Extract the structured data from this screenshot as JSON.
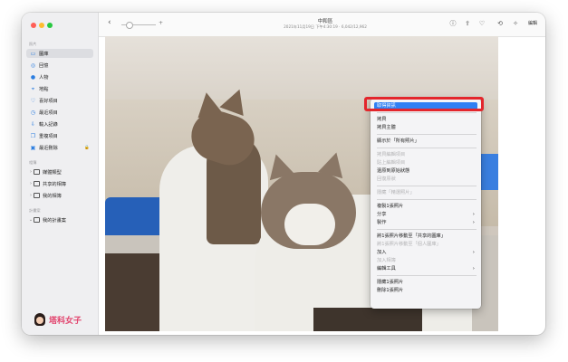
{
  "window": {
    "title": "中和區",
    "subtitle": "2021年11月19日 下午4:30:19 · 6,042/12,962"
  },
  "toolbar": {
    "back_icon": "chevron-left-icon",
    "zoom_plus": "+",
    "icons": [
      "info-icon",
      "share-icon",
      "heart-icon",
      "rotate-icon",
      "magic-wand-icon"
    ],
    "edit_label": "編輯"
  },
  "sidebar": {
    "section_photos": "照片",
    "items": [
      {
        "label": "圖庫",
        "icon": "photos-icon",
        "selected": true
      },
      {
        "label": "回憶",
        "icon": "memories-icon"
      },
      {
        "label": "人物",
        "icon": "people-icon"
      },
      {
        "label": "地點",
        "icon": "places-icon"
      },
      {
        "label": "喜好項目",
        "icon": "heart-icon"
      },
      {
        "label": "最近項目",
        "icon": "clock-icon"
      },
      {
        "label": "輸入記錄",
        "icon": "import-icon"
      },
      {
        "label": "重複項目",
        "icon": "duplicates-icon"
      },
      {
        "label": "最近刪除",
        "icon": "trash-icon",
        "locked": true
      }
    ],
    "section_albums": "相簿",
    "album_items": [
      {
        "label": "媒體類型"
      },
      {
        "label": "共享的相簿"
      },
      {
        "label": "我的相簿"
      }
    ],
    "section_projects": "計畫案",
    "project_items": [
      {
        "label": "我的計畫案"
      }
    ]
  },
  "logo": {
    "text": "塔科女子"
  },
  "context_menu": {
    "items": [
      {
        "label": "取得資訊",
        "highlighted": true
      },
      {
        "label": "拷貝"
      },
      {
        "label": "拷貝主體"
      },
      {
        "label": "顯示於「所有照片」"
      },
      {
        "label": "拷貝編輯項目",
        "disabled": true
      },
      {
        "label": "貼上編輯項目",
        "disabled": true
      },
      {
        "label": "還原到原始狀態",
        "disabled": true
      },
      {
        "label": "回復原狀",
        "disabled": true
      },
      {
        "label": "隱藏「精選照片」",
        "disabled": true
      },
      {
        "label": "複製1張照片"
      },
      {
        "label": "分享",
        "submenu": true
      },
      {
        "label": "製作",
        "submenu": true
      },
      {
        "label": "將1張照片移動至「共享的圖庫」"
      },
      {
        "label": "將1張照片移動至「個人圖庫」",
        "disabled": true
      },
      {
        "label": "加入",
        "submenu": true
      },
      {
        "label": "加入相簿",
        "disabled": true
      },
      {
        "label": "編輯工具",
        "submenu": true
      },
      {
        "label": "隱藏1張照片"
      },
      {
        "label": "刪除1張照片"
      }
    ]
  },
  "colors": {
    "accent": "#2f7ff3",
    "annotation": "#e3262c",
    "logo": "#e2466f"
  }
}
